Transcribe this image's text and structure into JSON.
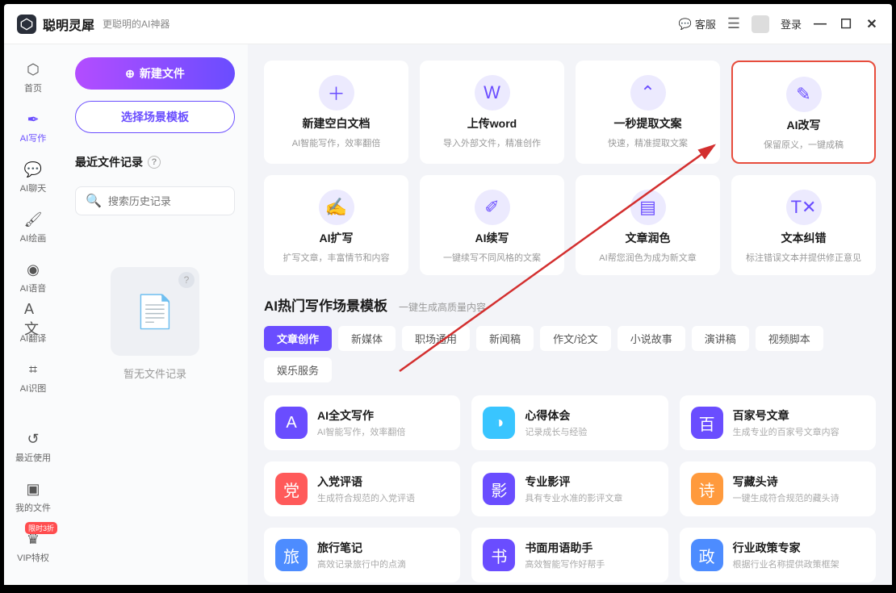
{
  "header": {
    "app_name": "聪明灵犀",
    "tagline": "更聪明的AI神器",
    "customer_service": "客服",
    "login": "登录"
  },
  "sidebar": {
    "items": [
      {
        "label": "首页"
      },
      {
        "label": "AI写作"
      },
      {
        "label": "AI聊天"
      },
      {
        "label": "AI绘画"
      },
      {
        "label": "AI语音"
      },
      {
        "label": "AI翻译"
      },
      {
        "label": "AI识图"
      },
      {
        "label": "最近使用"
      },
      {
        "label": "我的文件"
      },
      {
        "label": "VIP特权",
        "badge": "限时3折"
      }
    ]
  },
  "panel": {
    "new_file": "新建文件",
    "select_template": "选择场景模板",
    "recent_title": "最近文件记录",
    "search_placeholder": "搜索历史记录",
    "empty": "暂无文件记录"
  },
  "feature_cards": [
    {
      "title": "新建空白文档",
      "desc": "AI智能写作，效率翻倍",
      "icon": "＋"
    },
    {
      "title": "上传word",
      "desc": "导入外部文件，精准创作",
      "icon": "W"
    },
    {
      "title": "一秒提取文案",
      "desc": "快速，精准提取文案",
      "icon": "⌃"
    },
    {
      "title": "AI改写",
      "desc": "保留原义，一键成稿",
      "icon": "✎",
      "highlight": true
    },
    {
      "title": "AI扩写",
      "desc": "扩写文章，丰富情节和内容",
      "icon": "✍"
    },
    {
      "title": "AI续写",
      "desc": "一键续写不同风格的文案",
      "icon": "✐"
    },
    {
      "title": "文章润色",
      "desc": "AI帮您润色为成为新文章",
      "icon": "▤"
    },
    {
      "title": "文本纠错",
      "desc": "标注错误文本并提供修正意见",
      "icon": "T✕"
    }
  ],
  "template_section": {
    "heading": "AI热门写作场景模板",
    "sub": "一键生成高质量内容"
  },
  "tabs": [
    "文章创作",
    "新媒体",
    "职场通用",
    "新闻稿",
    "作文/论文",
    "小说故事",
    "演讲稿",
    "视频脚本",
    "娱乐服务"
  ],
  "templates": [
    {
      "title": "AI全文写作",
      "desc": "AI智能写作，效率翻倍",
      "color": "#6a4dff",
      "glyph": "A"
    },
    {
      "title": "心得体会",
      "desc": "记录成长与经验",
      "color": "#39c5ff",
      "glyph": "◑"
    },
    {
      "title": "百家号文章",
      "desc": "生成专业的百家号文章内容",
      "color": "#6a4dff",
      "glyph": "百"
    },
    {
      "title": "入党评语",
      "desc": "生成符合规范的入党评语",
      "color": "#ff5a5a",
      "glyph": "党"
    },
    {
      "title": "专业影评",
      "desc": "具有专业水准的影评文章",
      "color": "#6a4dff",
      "glyph": "影"
    },
    {
      "title": "写藏头诗",
      "desc": "一键生成符合规范的藏头诗",
      "color": "#ff9a3d",
      "glyph": "诗"
    },
    {
      "title": "旅行笔记",
      "desc": "高效记录旅行中的点滴",
      "color": "#4d8cff",
      "glyph": "旅"
    },
    {
      "title": "书面用语助手",
      "desc": "高效智能写作好帮手",
      "color": "#6a4dff",
      "glyph": "书"
    },
    {
      "title": "行业政策专家",
      "desc": "根据行业名称提供政策框架",
      "color": "#4d8cff",
      "glyph": "政"
    }
  ]
}
